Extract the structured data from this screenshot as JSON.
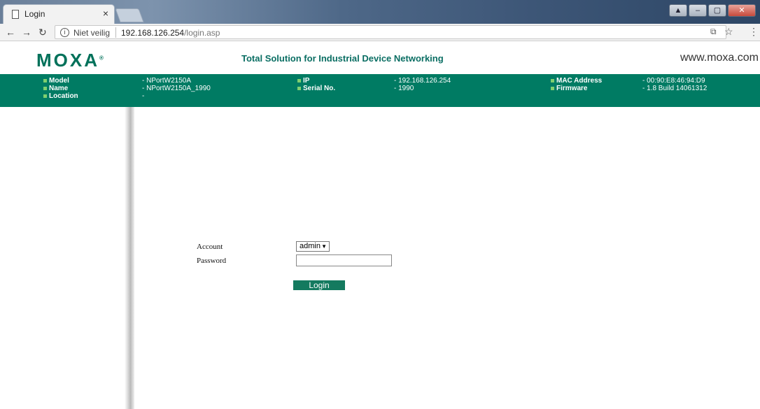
{
  "browser": {
    "tab_title": "Login",
    "tab_close": "×",
    "security_label": "Niet veilig",
    "url_host": "192.168.126.254",
    "url_path": "/login.asp"
  },
  "header": {
    "logo": "MOXA",
    "logo_mark": "®",
    "tagline": "Total Solution for Industrial Device Networking",
    "website": "www.moxa.com"
  },
  "device_info": {
    "model_label": "Model",
    "model_value": "- NPortW2150A",
    "name_label": "Name",
    "name_value": "- NPortW2150A_1990",
    "location_label": "Location",
    "location_value": "-",
    "ip_label": "IP",
    "ip_value": "- 192.168.126.254",
    "serial_label": "Serial No.",
    "serial_value": "- 1990",
    "mac_label": "MAC Address",
    "mac_value": "- 00:90:E8:46:94:D9",
    "firmware_label": "Firmware",
    "firmware_value": "- 1.8 Build 14061312"
  },
  "login": {
    "account_label": "Account",
    "account_selected": "admin",
    "password_label": "Password",
    "button_label": "Login"
  },
  "colors": {
    "brand_green": "#007b63",
    "button_green": "#147a5f"
  }
}
